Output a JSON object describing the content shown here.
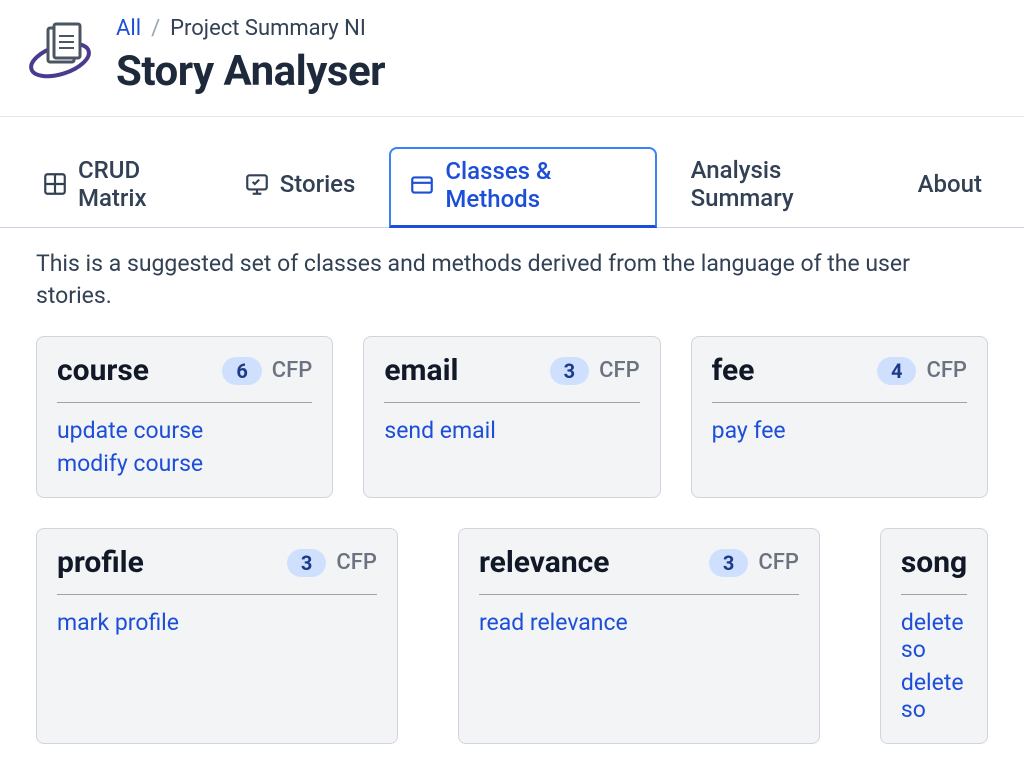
{
  "breadcrumb": {
    "root": "All",
    "current": "Project Summary NI"
  },
  "page_title": "Story Analyser",
  "tabs": [
    {
      "id": "crud",
      "label": "CRUD Matrix",
      "active": false
    },
    {
      "id": "stories",
      "label": "Stories",
      "active": false
    },
    {
      "id": "classes",
      "label": "Classes & Methods",
      "active": true
    },
    {
      "id": "summary",
      "label": "Analysis Summary",
      "active": false
    },
    {
      "id": "about",
      "label": "About",
      "active": false
    }
  ],
  "description": "This is a suggested set of classes and methods derived from the language of the user stories.",
  "cfp_label": "CFP",
  "cards_row1": [
    {
      "name": "course",
      "cfp": 6,
      "methods": [
        "update course",
        "modify course"
      ]
    },
    {
      "name": "email",
      "cfp": 3,
      "methods": [
        "send email"
      ]
    },
    {
      "name": "fee",
      "cfp": 4,
      "methods": [
        "pay fee"
      ]
    }
  ],
  "cards_row2": [
    {
      "name": "profile",
      "cfp": 3,
      "methods": [
        "mark profile"
      ]
    },
    {
      "name": "relevance",
      "cfp": 3,
      "methods": [
        "read relevance"
      ]
    },
    {
      "name": "song",
      "cfp": null,
      "methods": [
        "delete so",
        "delete so"
      ]
    }
  ]
}
